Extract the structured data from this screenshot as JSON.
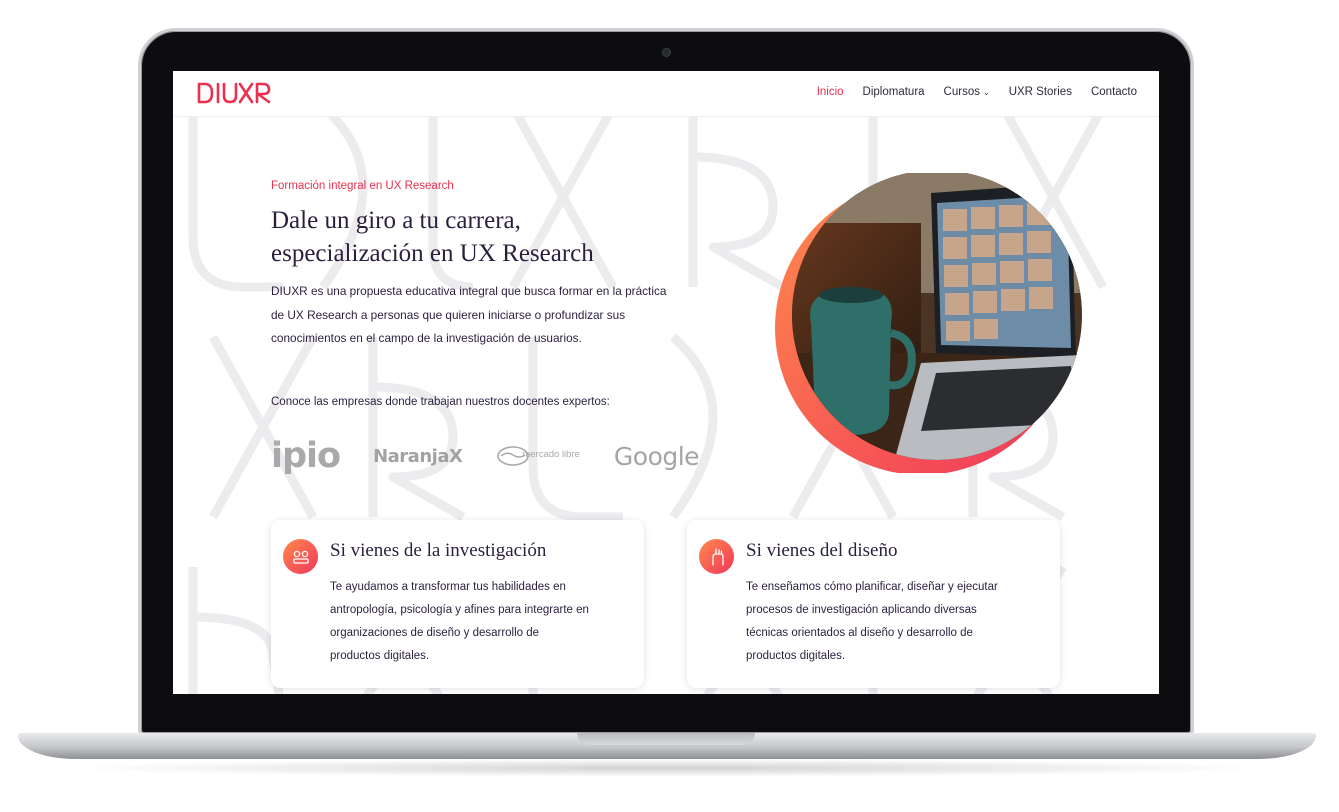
{
  "brand": {
    "logo_text": "DIUXR",
    "accent_color": "#e8314f"
  },
  "nav": {
    "items": [
      {
        "label": "Inicio",
        "active": true
      },
      {
        "label": "Diplomatura",
        "active": false
      },
      {
        "label": "Cursos",
        "active": false,
        "has_dropdown": true
      },
      {
        "label": "UXR Stories",
        "active": false
      },
      {
        "label": "Contacto",
        "active": false
      }
    ]
  },
  "hero": {
    "eyebrow": "Formación integral en UX Research",
    "title_line1": "Dale un giro a tu carrera,",
    "title_line2": "especialización en UX Research",
    "intro_line1": "DIUXR es una propuesta educativa integral que busca formar en la práctica",
    "intro_line2": "de UX Research a personas que quieren iniciarse o profundizar sus",
    "intro_line3": "conocimientos en el campo de la investigación de usuarios.",
    "image_icon": "video-call-laptop-photo"
  },
  "companies": {
    "label": "Conoce las empresas donde trabajan nuestros docentes expertos:",
    "logos": [
      "ipio",
      "NaranjaX",
      "mercado libre",
      "Google"
    ]
  },
  "cards": [
    {
      "icon": "research-icon",
      "title": "Si vienes de la investigación",
      "line1": "Te ayudamos a transformar tus habilidades en",
      "line2": "antropología, psicología y afines para integrarte en",
      "line3": "organizaciones de diseño y desarrollo de",
      "line4": "productos digitales."
    },
    {
      "icon": "design-icon",
      "title": "Si vienes del diseño",
      "line1": "Te enseñamos cómo planificar, diseñar y ejecutar",
      "line2": "procesos de investigación aplicando diversas",
      "line3": "técnicas orientados al diseño y desarrollo de",
      "line4": "productos digitales."
    }
  ]
}
